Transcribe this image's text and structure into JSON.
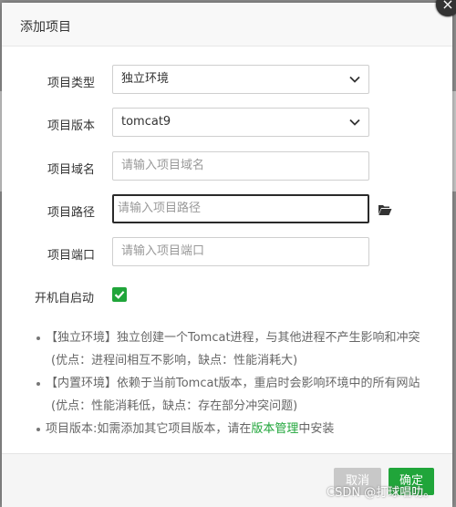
{
  "dialog": {
    "title": "添加项目",
    "close_glyph": "×"
  },
  "form": {
    "type_label": "项目类型",
    "type_value": "独立环境",
    "version_label": "项目版本",
    "version_value": "tomcat9",
    "domain_label": "项目域名",
    "domain_placeholder": "请输入项目域名",
    "path_label": "项目路径",
    "path_placeholder": "请输入项目路径",
    "port_label": "项目端口",
    "port_placeholder": "请输入项目端口",
    "autostart_label": "开机自启动",
    "autostart_checked": true
  },
  "notes": {
    "line1": "【独立环境】独立创建一个Tomcat进程，与其他进程不产生影响和冲突",
    "line2": "(优点：进程间相互不影响，缺点：性能消耗大)",
    "line3": "【内置环境】依赖于当前Tomcat版本，重启时会影响环境中的所有网站",
    "line4": "(优点：性能消耗低，缺点：存在部分冲突问题)",
    "line5_prefix": "项目版本:如需添加其它项目版本，请在",
    "line5_link": "版本管理",
    "line5_suffix": "中安装"
  },
  "footer": {
    "cancel_label": "取消",
    "confirm_label": "确定"
  },
  "watermark": "CSDN @打球唱叻。",
  "icons": {
    "dropdown": "chevron-down-icon",
    "folder": "folder-open-icon",
    "check": "checkmark-icon",
    "close": "close-icon"
  },
  "colors": {
    "accent": "#20a53a",
    "cancel": "#c8c8c8"
  }
}
